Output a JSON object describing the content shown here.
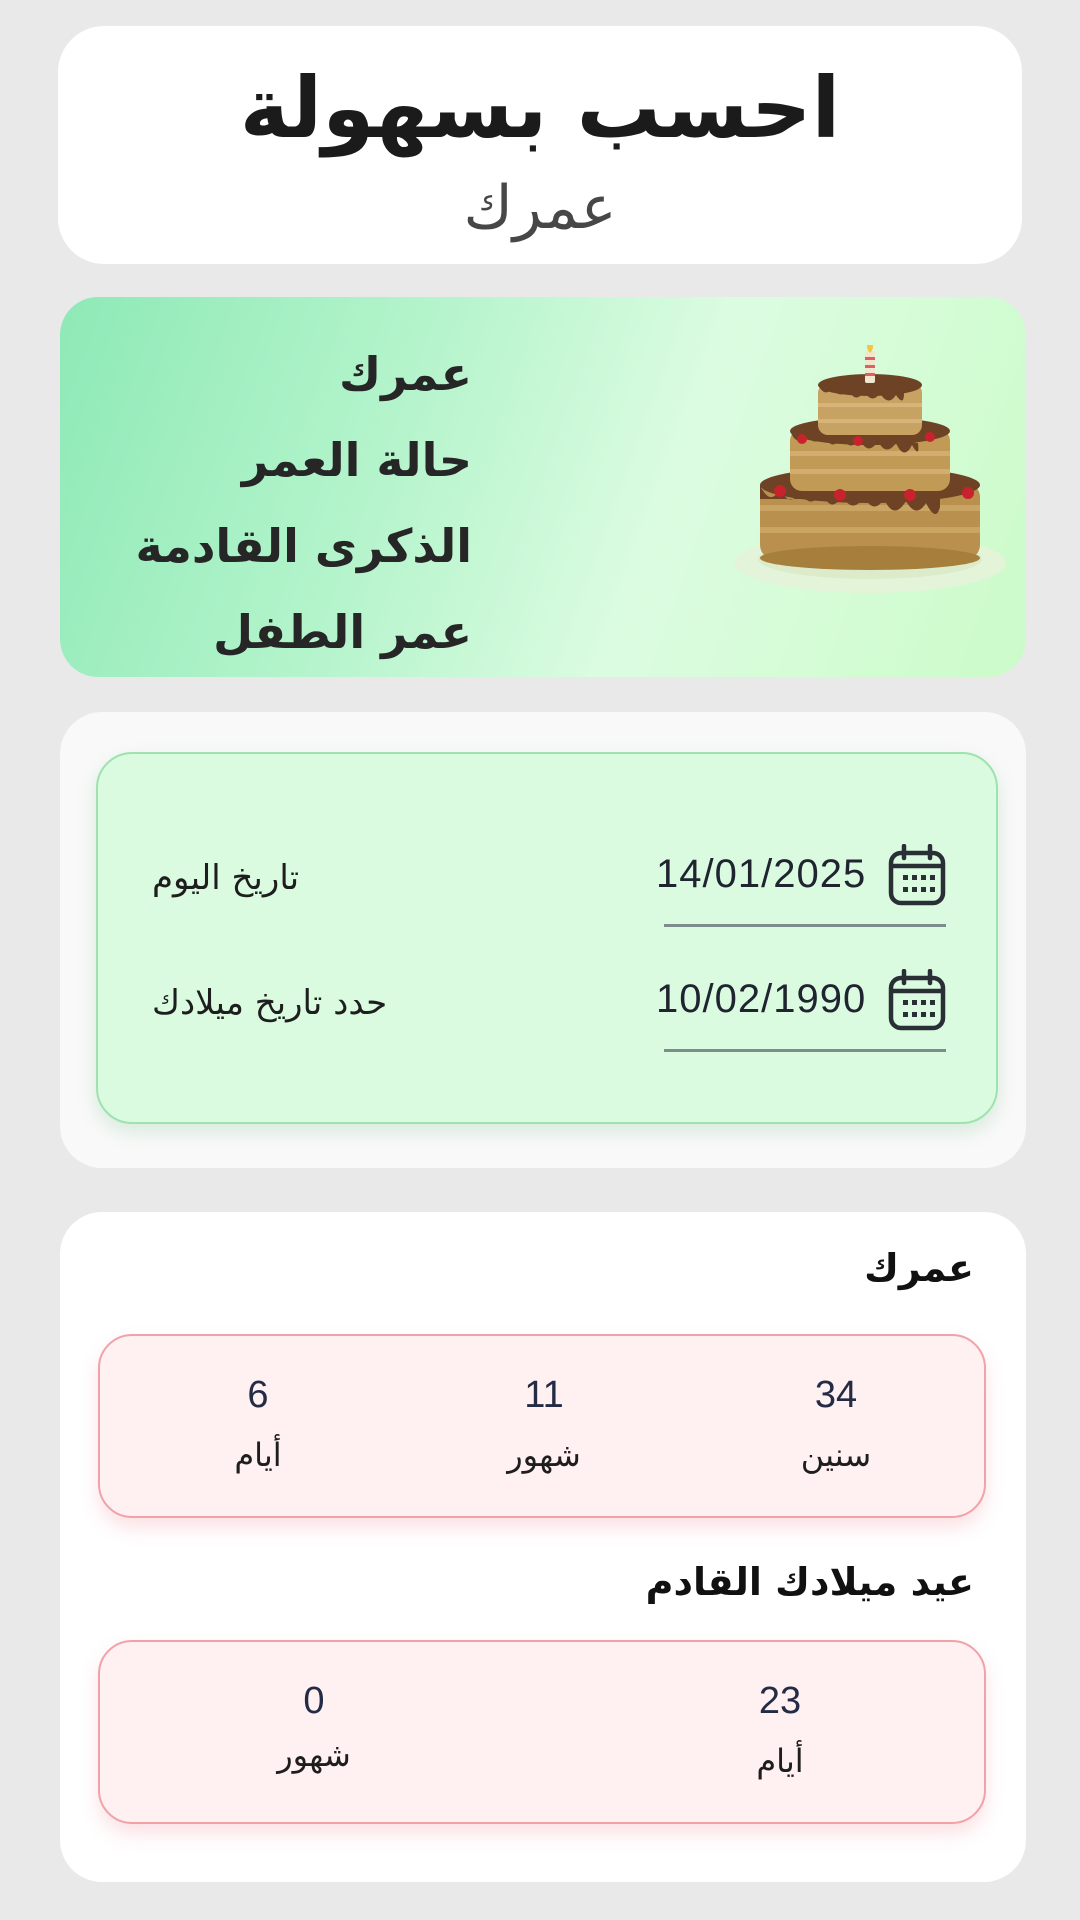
{
  "header": {
    "title": "احسب بسهولة",
    "subtitle": "عمرك"
  },
  "banner": {
    "items": [
      "عمرك",
      "حالة العمر",
      "الذكرى القادمة",
      "عمر الطفل"
    ],
    "image_icon": "birthday-cake"
  },
  "dates": {
    "today": {
      "label": "تاريخ اليوم",
      "value": "14/01/2025",
      "icon": "calendar-icon"
    },
    "birth": {
      "label": "حدد تاريخ ميلادك",
      "value": "10/02/1990",
      "icon": "calendar-icon"
    }
  },
  "age": {
    "title": "عمرك",
    "years": {
      "value": "34",
      "label": "سنين"
    },
    "months": {
      "value": "11",
      "label": "شهور"
    },
    "days": {
      "value": "6",
      "label": "أيام"
    }
  },
  "next_birthday": {
    "title": "عيد ميلادك القادم",
    "days": {
      "value": "23",
      "label": "أيام"
    },
    "months": {
      "value": "0",
      "label": "شهور"
    }
  },
  "colors": {
    "background": "#e9e9e9",
    "banner_green": "#8ee9b7",
    "dates_panel": "#dbfbe0",
    "result_panel": "#fff0f1",
    "result_border": "#f0a2a8"
  }
}
